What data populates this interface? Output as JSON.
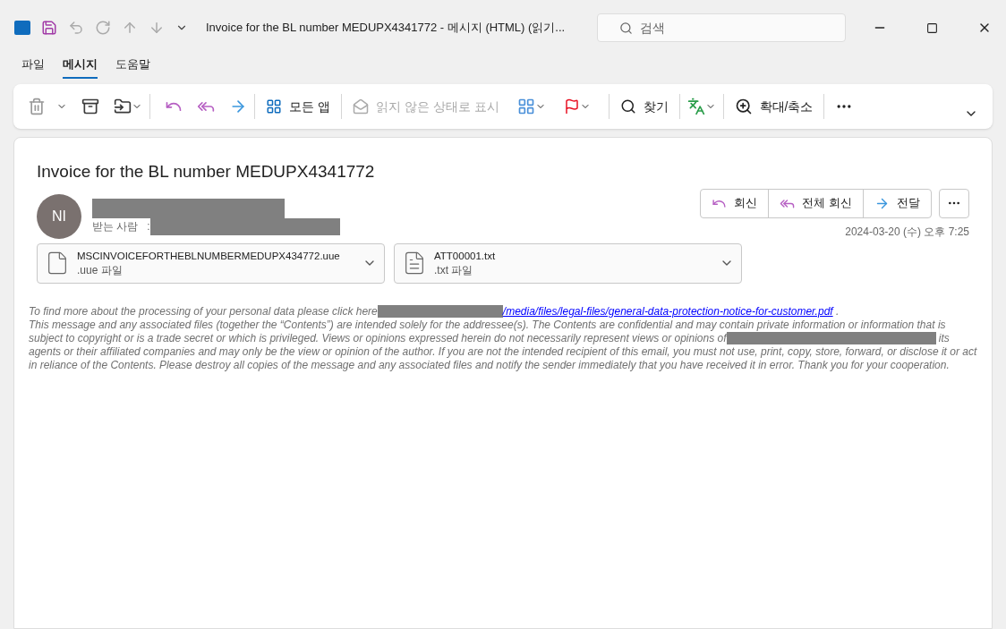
{
  "window": {
    "title": "Invoice for the BL number MEDUPX4341772  -  메시지 (HTML) (읽기...",
    "search_placeholder": "검색"
  },
  "tabs": [
    {
      "label": "파일",
      "selected": false
    },
    {
      "label": "메시지",
      "selected": true
    },
    {
      "label": "도움말",
      "selected": false
    }
  ],
  "ribbon": {
    "all_apps": "모든 앱",
    "mark_unread": {
      "label": "읽지 않은 상태로 표시",
      "disabled": true
    },
    "find": "찾기",
    "zoom": "확대/축소"
  },
  "message": {
    "subject": "Invoice for the BL number MEDUPX4341772",
    "avatar_initials": "NI",
    "to_label": "받는 사람   :",
    "actions": [
      {
        "kind": "reply",
        "label": "회신"
      },
      {
        "kind": "reply_all",
        "label": "전체 회신"
      },
      {
        "kind": "forward",
        "label": "전달"
      }
    ],
    "date": "2024-03-20 (수) 오후 7:25",
    "attachments": [
      {
        "kind": "blank",
        "name": "MSCINVOICEFORTHEBLNUMBERMEDUPX434772.uue",
        "type": ".uue 파일"
      },
      {
        "kind": "text",
        "name": "ATT00001.txt",
        "type": ".txt 파일"
      }
    ],
    "body": [
      [
        {
          "kind": "text",
          "text": "To find more about the processing of your personal data please click here"
        },
        {
          "kind": "redacted"
        },
        {
          "kind": "link",
          "text": "/media/files/legal-files/general-data-protection-notice-for-customer.pdf"
        },
        {
          "kind": "text",
          "text": " ."
        }
      ],
      [
        {
          "kind": "text",
          "text": "This message and any associated files (together the “Contents”) are intended solely for the addressee(s). The Contents are confidential and may contain private information or information that is subject to copyright or is a trade secret or which is privileged. Views or opinions expressed herein do not necessarily represent views or opinions of"
        },
        {
          "kind": "redacted"
        },
        {
          "kind": "redacted"
        },
        {
          "kind": "text",
          "text": " its agents or their affiliated companies and may only be the view or opinion of the author. If you are not the intended recipient of this email, you must not use, print, copy, store, forward, or disclose it or act in reliance of the Contents. Please destroy all copies of the message and any associated files and notify the sender immediately that you have received it in error. Thank you for your cooperation."
        }
      ]
    ]
  }
}
